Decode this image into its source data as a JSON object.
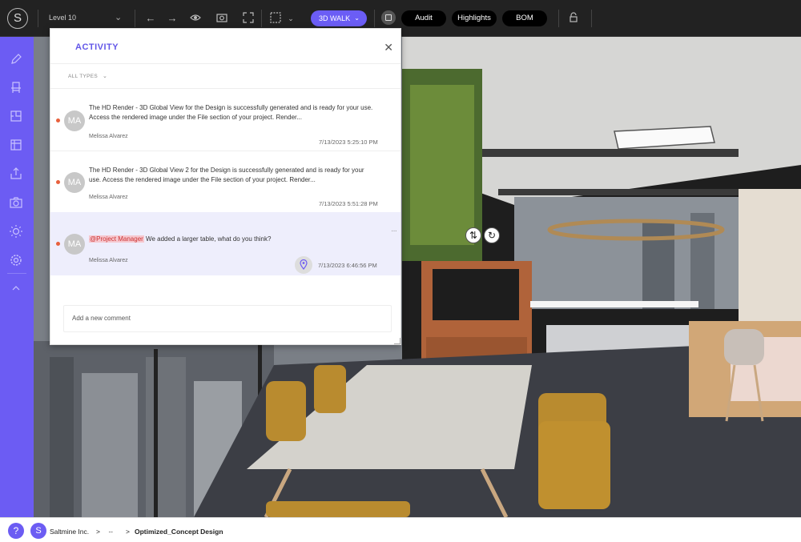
{
  "app": {
    "logo_letter": "S"
  },
  "toolbar": {
    "level_label": "Level 10",
    "walk_label": "3D WALK",
    "audit_label": "Audit",
    "highlights_label": "Highlights",
    "bom_label": "BOM"
  },
  "panel": {
    "title": "ACTIVITY",
    "filter_label": "ALL TYPES",
    "comment_placeholder": "Add a new comment",
    "items": [
      {
        "avatar": "MA",
        "text": "The HD Render - 3D Global View for the Design is successfully generated and is ready for your use. Access the rendered image under the File section of your project. Render...",
        "author": "Melissa Alvarez",
        "timestamp": "7/13/2023 5:25:10 PM"
      },
      {
        "avatar": "MA",
        "text": "The HD Render - 3D Global View 2 for the Design is successfully generated and is ready for your use. Access the rendered image under the File section of your project. Render...",
        "author": "Melissa Alvarez",
        "timestamp": "7/13/2023 5:51:28 PM"
      },
      {
        "avatar": "MA",
        "mention": "@Project Manager",
        "text": " We added a larger table, what do you think?",
        "author": "Melissa Alvarez",
        "timestamp": "7/13/2023 6:46:56 PM",
        "more": "···"
      }
    ]
  },
  "breadcrumb": {
    "help": "?",
    "org_avatar": "S",
    "org": "Saltmine Inc.",
    "sep1": ">",
    "ellipsis": "···",
    "sep2": ">",
    "design": "Optimized_Concept Design"
  },
  "colors": {
    "accent": "#6c5cf3",
    "walk": "#6b5df5",
    "unread_dot": "#e8603c",
    "mention_bg": "#f6c8cf"
  }
}
